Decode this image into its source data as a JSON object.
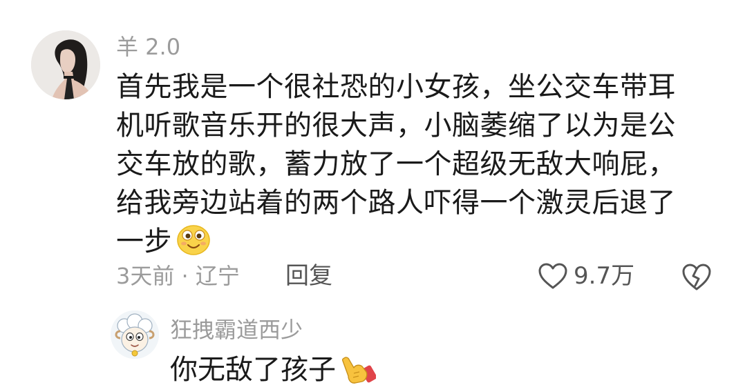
{
  "main_comment": {
    "username": "羊 2.0",
    "avatar_icon": "user-avatar-photo",
    "lines": [
      "首先我是一个很社恐的小女孩，坐公交车带耳",
      "机听歌音乐开的很大声，小脑萎缩了以为是公",
      "交车放的歌，蓄力放了一个超级无敌大响屁，",
      "给我旁边站着的两个路人吓得一个激灵后退了",
      "一步"
    ],
    "trailing_emoji": "grinning-face-emoji",
    "meta": "3天前 · 辽宁",
    "reply_label": "回复",
    "like_count": "9.7万",
    "like_icon": "heart-outline-icon",
    "dislike_icon": "broken-heart-icon"
  },
  "reply_comment": {
    "username": "狂拽霸道西少",
    "avatar_icon": "cartoon-sheep-avatar",
    "text": "你无敌了孩子",
    "trailing_emoji": "pointing-hand-emoji"
  }
}
